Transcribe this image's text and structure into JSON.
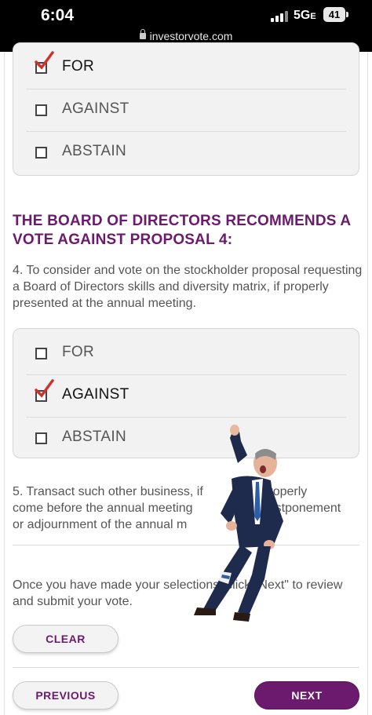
{
  "status_bar": {
    "time": "6:04",
    "network": "5G",
    "battery": "41",
    "url": "investorvote.com"
  },
  "proposal3": {
    "options": [
      {
        "label": "FOR",
        "checked": true
      },
      {
        "label": "AGAINST",
        "checked": false
      },
      {
        "label": "ABSTAIN",
        "checked": false
      }
    ]
  },
  "proposal4": {
    "heading": "THE BOARD OF DIRECTORS RECOMMENDS A VOTE AGAINST PROPOSAL 4:",
    "description": "4. To consider and vote on the stockholder proposal requesting a Board of Directors skills and diversity matrix, if properly presented at the annual meeting.",
    "options": [
      {
        "label": "FOR",
        "checked": false
      },
      {
        "label": "AGAINST",
        "checked": true
      },
      {
        "label": "ABSTAIN",
        "checked": false
      }
    ]
  },
  "item5": {
    "line1": "5. Transact such other business, if",
    "line1_end": "may properly",
    "line2": "come before the annual meeting",
    "line2_end": "ny postponement",
    "line3": "or adjournment of the annual m"
  },
  "instructions": "Once you have made your selections, click \"Next\" to review and submit your vote.",
  "buttons": {
    "clear": "CLEAR",
    "previous": "PREVIOUS",
    "next": "NEXT"
  },
  "colors": {
    "accent": "#6b1a6e",
    "check": "#d0312d"
  }
}
